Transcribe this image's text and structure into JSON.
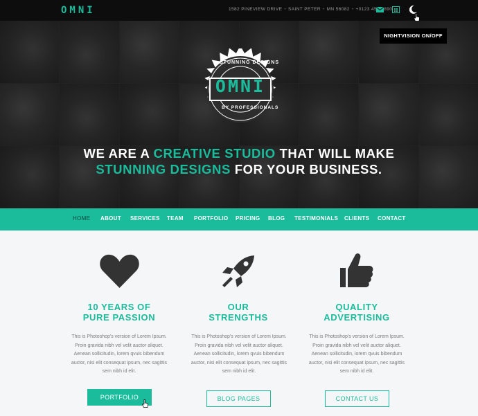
{
  "topbar": {
    "logo": "OMNI",
    "address": [
      "1582 PINEVIEW DRIVE",
      "SAINT PETER",
      "MN 56082",
      "+0123 456 7890"
    ],
    "icons": [
      "mail-icon",
      "calendar-icon",
      "moon-icon"
    ]
  },
  "hero": {
    "nightvision_label": "NIGHTVISION ON/OFF",
    "badge_top": "STUNNING DESIGNS",
    "badge_word": "OMNI",
    "badge_bottom": "BY PROFESSIONALS",
    "tagline": {
      "line1_a": "WE ARE A ",
      "line1_b": "CREATIVE STUDIO",
      "line1_c": " THAT WILL MAKE",
      "line2_a": "STUNNING DESIGNS",
      "line2_b": " FOR YOUR BUSINESS."
    }
  },
  "nav": {
    "items": [
      "HOME",
      "ABOUT",
      "SERVICES",
      "TEAM",
      "PORTFOLIO",
      "PRICING",
      "BLOG",
      "TESTIMONIALS",
      "CLIENTS",
      "CONTACT"
    ],
    "active": "HOME"
  },
  "features": [
    {
      "icon": "heart-icon",
      "title_line1": "10 YEARS OF",
      "title_line2": "PURE PASSION",
      "text": "This is Photoshop's version of Lorem Ipsum. Proin gravida nibh vel velit auctor aliquet. Aenean sollicitudin, lorem qvuis bibendum auctor, nisi elit consequat ipsum, nec sagittis sem nibh id elit.",
      "button": "PORTFOLIO"
    },
    {
      "icon": "rocket-icon",
      "title_line1": "OUR",
      "title_line2": "STRENGTHS",
      "text": "This is Photoshop's version of Lorem Ipsum. Proin gravida nibh vel velit auctor aliquet. Aenean sollicitudin, lorem qvuis bibendum auctor, nisi elit consequat ipsum, nec sagittis sem nibh id elit.",
      "button": "BLOG PAGES"
    },
    {
      "icon": "thumbs-up-icon",
      "title_line1": "QUALITY",
      "title_line2": "ADVERTISING",
      "text": "This is Photoshop's version of Lorem Ipsum. Proin gravida nibh vel velit auctor aliquet. Aenean sollicitudin, lorem qvuis bibendum auctor, nisi elit consequat ipsum, nec sagittis sem nibh id elit.",
      "button": "CONTACT US"
    }
  ],
  "colors": {
    "accent": "#1abc9c",
    "topbar_bg": "#0d0d0d",
    "page_bg": "#f5f6f8",
    "icon_dark": "#333333"
  }
}
